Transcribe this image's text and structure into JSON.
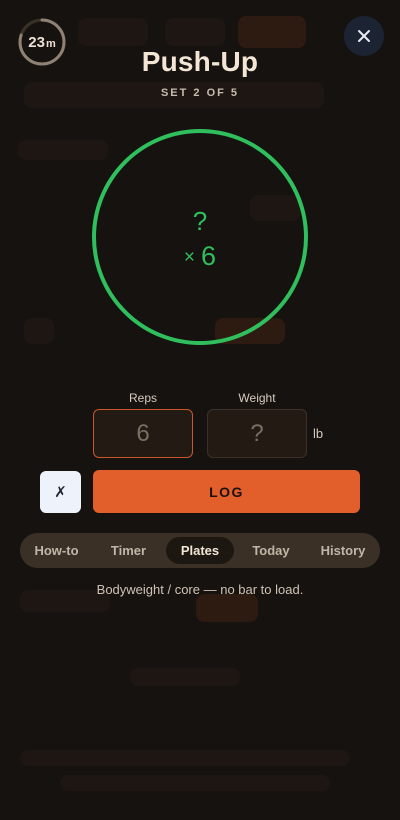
{
  "timer": {
    "value": "23",
    "unit": "m",
    "progress": 0.8
  },
  "exercise": {
    "name": "Push-Up",
    "set_label": "SET 2 OF 5"
  },
  "ring": {
    "weight_display": "?",
    "times_symbol": "×",
    "reps_display": "6",
    "color": "#2fbf5c"
  },
  "fields": {
    "reps_label": "Reps",
    "reps_value": "6",
    "weight_label": "Weight",
    "weight_value": "?",
    "weight_unit": "lb"
  },
  "actions": {
    "skip_label": "✗",
    "log_label": "LOG"
  },
  "tabs": [
    {
      "label": "How-to",
      "active": false
    },
    {
      "label": "Timer",
      "active": false
    },
    {
      "label": "Plates",
      "active": true
    },
    {
      "label": "Today",
      "active": false
    },
    {
      "label": "History",
      "active": false
    }
  ],
  "plates_note": "Bodyweight / core — no bar to load.",
  "colors": {
    "accent": "#e25f2b",
    "ring": "#2fbf5c",
    "background": "#161210"
  }
}
